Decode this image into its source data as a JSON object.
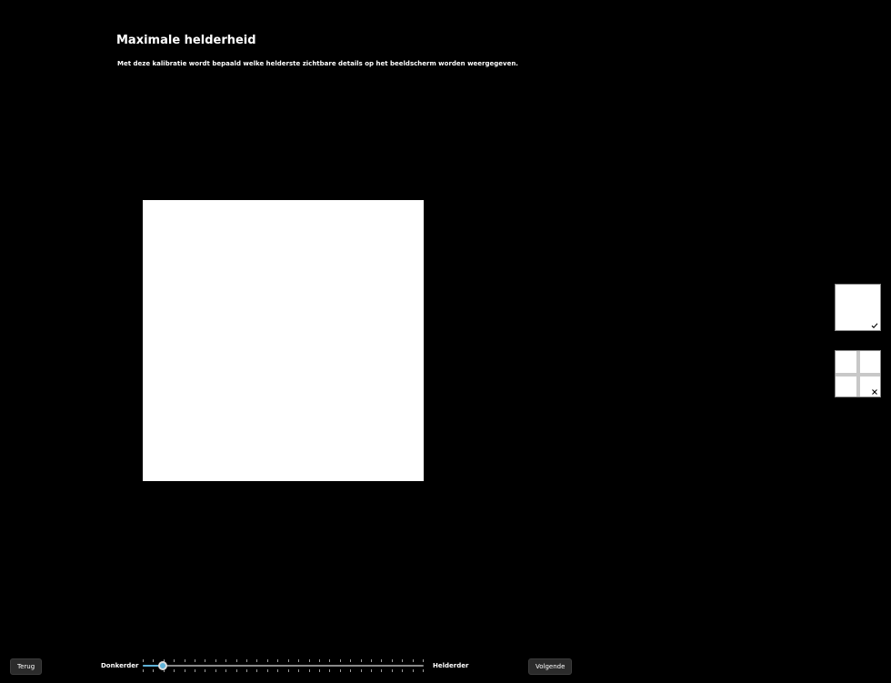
{
  "page": {
    "title": "Maximale helderheid",
    "description": "Met deze kalibratie wordt bepaald welke helderste zichtbare details op het beeldscherm worden weergegeven."
  },
  "reference_images": {
    "good_icon": "checkmark-icon",
    "bad_icon": "x-mark-icon"
  },
  "navigation": {
    "back_label": "Terug",
    "next_label": "Volgende"
  },
  "slider": {
    "min_label": "Donkerder",
    "max_label": "Helderder",
    "value_fraction": 0.07,
    "tick_count": 28,
    "accent_color": "#5fb2d8"
  }
}
